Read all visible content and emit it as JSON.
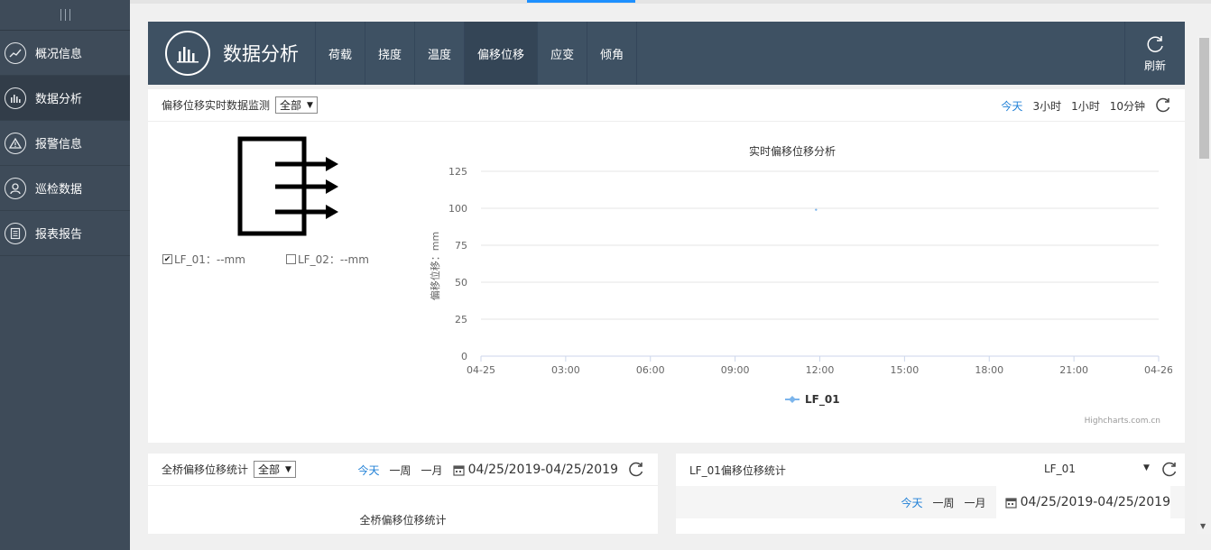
{
  "sidebar": {
    "items": [
      {
        "label": "概况信息",
        "icon": "trend-icon"
      },
      {
        "label": "数据分析",
        "icon": "bar-chart-icon",
        "active": true
      },
      {
        "label": "报警信息",
        "icon": "warning-icon"
      },
      {
        "label": "巡检数据",
        "icon": "inspector-icon"
      },
      {
        "label": "报表报告",
        "icon": "report-icon"
      }
    ]
  },
  "header": {
    "title": "数据分析",
    "tabs": [
      {
        "label": "荷载"
      },
      {
        "label": "挠度"
      },
      {
        "label": "温度"
      },
      {
        "label": "偏移位移",
        "active": true
      },
      {
        "label": "应变"
      },
      {
        "label": "倾角"
      }
    ],
    "refresh_label": "刷新"
  },
  "realtime": {
    "title": "偏移位移实时数据监测",
    "select_value": "全部",
    "ranges": [
      "今天",
      "3小时",
      "1小时",
      "10分钟"
    ],
    "sensors": [
      {
        "label": "LF_01：--mm",
        "checked": true
      },
      {
        "label": "LF_02：--mm",
        "checked": false
      }
    ]
  },
  "chart_data": {
    "type": "line",
    "title": "实时偏移位移分析",
    "ylabel": "偏移位移：mm",
    "xlabel": "",
    "x_ticks": [
      "04-25",
      "03:00",
      "06:00",
      "09:00",
      "12:00",
      "15:00",
      "18:00",
      "21:00",
      "04-26"
    ],
    "y_ticks": [
      0,
      25,
      50,
      75,
      100,
      125
    ],
    "ylim": [
      0,
      125
    ],
    "series": [
      {
        "name": "LF_01",
        "color": "#7cb5ec",
        "points": [
          {
            "x": "11:52",
            "y": 99
          }
        ]
      }
    ],
    "legend": "bottom-center",
    "grid": true,
    "credits": "Highcharts.com.cn"
  },
  "bridge_stats": {
    "title": "全桥偏移位移统计",
    "select_value": "全部",
    "ranges": [
      "今天",
      "一周",
      "一月"
    ],
    "date_range": "04/25/2019-04/25/2019",
    "chart_title": "全桥偏移位移统计"
  },
  "lf01_stats": {
    "title": "LF_01偏移位移统计",
    "select_value": "LF_01",
    "ranges": [
      "今天",
      "一周",
      "一月"
    ],
    "date_range": "04/25/2019-04/25/2019"
  },
  "colors": {
    "sidebar_bg": "#3e4b59",
    "header_bg": "#3e5163",
    "accent": "#1e7fd6",
    "series": "#7cb5ec"
  }
}
